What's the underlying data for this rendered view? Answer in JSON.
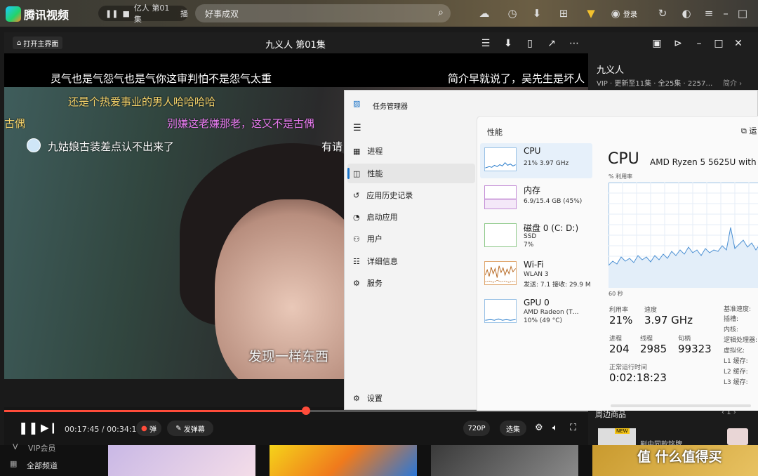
{
  "app": {
    "name": "腾讯视频",
    "mini_player": "亿人 第01集",
    "mini_cast": "播",
    "search_placeholder": "好事成双",
    "login": "登录"
  },
  "player": {
    "home": "打开主界面",
    "title": "九义人 第01集",
    "subtitle": "发现一样东西",
    "time_current": "00:17:45",
    "time_sep": "/",
    "time_total": "00:34:19",
    "progress": 0.517,
    "danmu_toggle": "弹",
    "send_danmu": "发弹幕",
    "quality": "720P",
    "episodes": "选集",
    "danmu": [
      {
        "text": "灵气也是气怨气也是气你这审判怕不是怨气太重",
        "color": "#ffffff"
      },
      {
        "text": "简介早就说了，吴先生是坏人",
        "color": "#ffffff"
      },
      {
        "text": "还是个热爱事业的男人哈哈哈哈",
        "color": "#f5d36b"
      },
      {
        "text": "古偶",
        "color": "#f5d36b"
      },
      {
        "text": "别嫌这老嫌那老，这又不是古偶",
        "color": "#e87cf0"
      },
      {
        "text": "九姑娘古装差点认不出来了",
        "color": "#ffffff"
      },
      {
        "text": "有请",
        "color": "#ffffff"
      }
    ]
  },
  "side_panel": {
    "title": "九义人",
    "meta": "VIP · 更新至11集 · 全25集 · 2257…",
    "intro": "简介",
    "peripheral": "周边商品",
    "page": "1",
    "new_badge": "NEW",
    "product": "剧中同款铭牌"
  },
  "bottom": {
    "vip": "VIP会员",
    "all": "全部频道",
    "watermark": "值 什么值得买"
  },
  "task_manager": {
    "title": "任务管理器",
    "nav": [
      "进程",
      "性能",
      "应用历史记录",
      "启动应用",
      "用户",
      "详细信息",
      "服务"
    ],
    "settings": "设置",
    "section": "性能",
    "run_task": "运",
    "tiles": [
      {
        "name": "CPU",
        "line1": "21% 3.97 GHz",
        "line2": ""
      },
      {
        "name": "内存",
        "line1": "6.9/15.4 GB (45%)",
        "line2": ""
      },
      {
        "name": "磁盘 0 (C: D:)",
        "line1": "SSD",
        "line2": "7%"
      },
      {
        "name": "Wi-Fi",
        "line1": "WLAN 3",
        "line2": "发送: 7.1  接收: 29.9 M"
      },
      {
        "name": "GPU 0",
        "line1": "AMD Radeon (T…",
        "line2": "10% (49 °C)"
      }
    ],
    "cpu": {
      "heading": "CPU",
      "model": "AMD Ryzen 5 5625U with",
      "util_label": "% 利用率",
      "time_label": "60 秒",
      "util": "21%",
      "util_title": "利用率",
      "speed_title": "速度",
      "speed": "3.97 GHz",
      "proc_title": "进程",
      "proc": "204",
      "threads_title": "线程",
      "threads": "2985",
      "handles_title": "句柄",
      "handles": "99323",
      "uptime_title": "正常运行时间",
      "uptime": "0:02:18:23",
      "right_labels": [
        "基准速度:",
        "插槽:",
        "内核:",
        "逻辑处理器:",
        "虚拟化:",
        "L1 缓存:",
        "L2 缓存:",
        "L3 缓存:"
      ]
    }
  }
}
